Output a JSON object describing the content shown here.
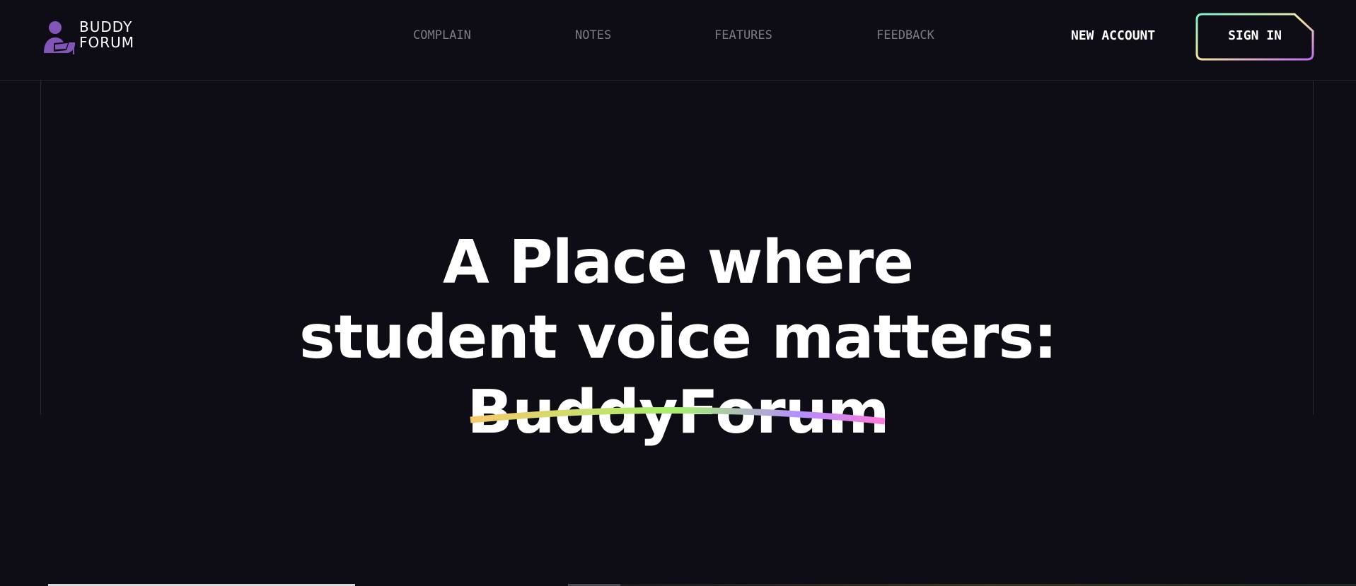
{
  "header": {
    "logo": {
      "line1": "BUDDY",
      "line2": "FORUM",
      "icon": "student-reading-icon",
      "icon_color": "#8256b8"
    },
    "nav": [
      {
        "label": "COMPLAIN"
      },
      {
        "label": "NOTES"
      },
      {
        "label": "FEATURES"
      },
      {
        "label": "FEEDBACK"
      }
    ],
    "new_account_label": "NEW ACCOUNT",
    "sign_in_label": "SIGN IN"
  },
  "hero": {
    "line1": "A Place where",
    "line2": "student voice matters:",
    "brand": "BuddyForum"
  },
  "colors": {
    "background": "#0e0d16",
    "nav_text": "#7c7b86",
    "text": "#ffffff",
    "underline_gradient": [
      "#f7c96a",
      "#a6f070",
      "#b58cff",
      "#ff7ad9"
    ]
  }
}
